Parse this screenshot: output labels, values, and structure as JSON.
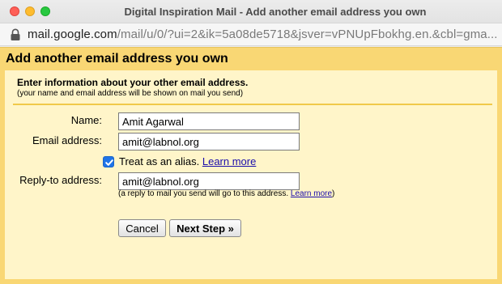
{
  "window": {
    "title": "Digital Inspiration Mail - Add another email address you own"
  },
  "address_bar": {
    "host": "mail.google.com",
    "path": "/mail/u/0/?ui=2&ik=5a08de5718&jsver=vPNUpFbokhg.en.&cbl=gma..."
  },
  "dialog": {
    "heading": "Add another email address you own",
    "intro_title": "Enter information about your other email address.",
    "intro_subtitle": "(your name and email address will be shown on mail you send)"
  },
  "form": {
    "name_label": "Name:",
    "name_value": "Amit Agarwal",
    "email_label": "Email address:",
    "email_value": "amit@labnol.org",
    "alias_checked": true,
    "alias_label": "Treat as an alias.",
    "alias_link": "Learn more",
    "reply_to_label": "Reply-to address:",
    "reply_to_value": "amit@labnol.org",
    "reply_hint": "(a reply to mail you send will go to this address.",
    "reply_hint_link": "Learn more",
    "reply_hint_close": ")"
  },
  "buttons": {
    "cancel": "Cancel",
    "next": "Next Step »"
  },
  "colors": {
    "header_bg": "#f9d774",
    "page_bg": "#fff5c9",
    "divider": "#f0c94a",
    "checkbox": "#1f74e8",
    "link": "#1a0dab"
  }
}
